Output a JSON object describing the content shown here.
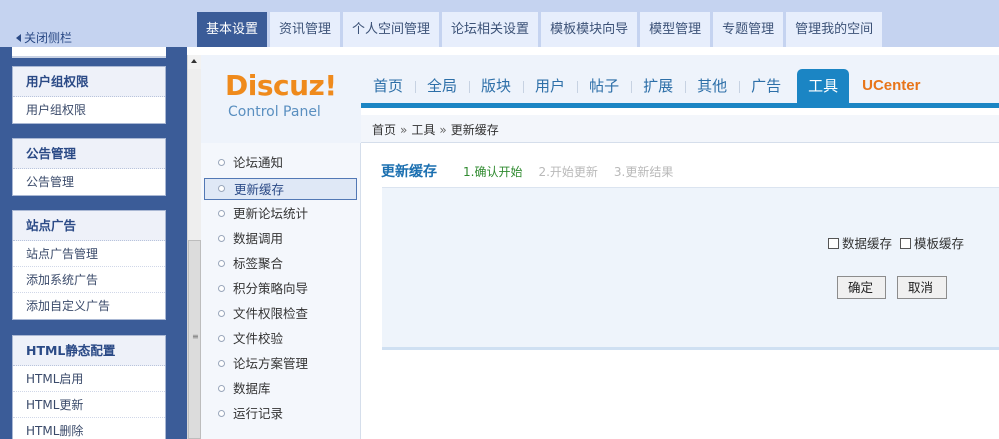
{
  "topbar": {
    "close_sidebar": "关闭侧栏",
    "tabs": [
      "基本设置",
      "资讯管理",
      "个人空间管理",
      "论坛相关设置",
      "模板模块向导",
      "模型管理",
      "专题管理",
      "管理我的空间"
    ],
    "active_tab": 0
  },
  "sidebar": {
    "groups": [
      {
        "title": "用户组权限",
        "items": [
          "用户组权限"
        ]
      },
      {
        "title": "公告管理",
        "items": [
          "公告管理"
        ]
      },
      {
        "title": "站点广告",
        "items": [
          "站点广告管理",
          "添加系统广告",
          "添加自定义广告"
        ]
      },
      {
        "title": "HTML静态配置",
        "items": [
          "HTML启用",
          "HTML更新",
          "HTML删除"
        ]
      }
    ]
  },
  "logo": {
    "name": "Discuz!",
    "sub": "Control Panel"
  },
  "nav": {
    "items": [
      "首页",
      "全局",
      "版块",
      "用户",
      "帖子",
      "扩展",
      "其他",
      "广告",
      "工具",
      "UCenter"
    ],
    "active": 8
  },
  "breadcrumb": {
    "items": [
      "首页",
      "工具",
      "更新缓存"
    ],
    "separator": "»"
  },
  "submenu": {
    "items": [
      "论坛通知",
      "更新缓存",
      "更新论坛统计",
      "数据调用",
      "标签聚合",
      "积分策略向导",
      "文件权限检查",
      "文件校验",
      "论坛方案管理",
      "数据库",
      "运行记录"
    ],
    "active": 1
  },
  "main": {
    "title": "更新缓存",
    "steps": [
      "1.确认开始",
      "2.开始更新",
      "3.更新结果"
    ],
    "current_step": 0,
    "options": [
      {
        "label": "数据缓存",
        "checked": false
      },
      {
        "label": "模板缓存",
        "checked": false
      }
    ],
    "ok_label": "确定",
    "cancel_label": "取消"
  },
  "colors": {
    "sidebar_bg": "#3b5c98",
    "topbar_bg": "#c5d3f0",
    "accent": "#1b85c4",
    "logo_orange": "#ef8a1c",
    "step_current": "#2f8a2f"
  }
}
